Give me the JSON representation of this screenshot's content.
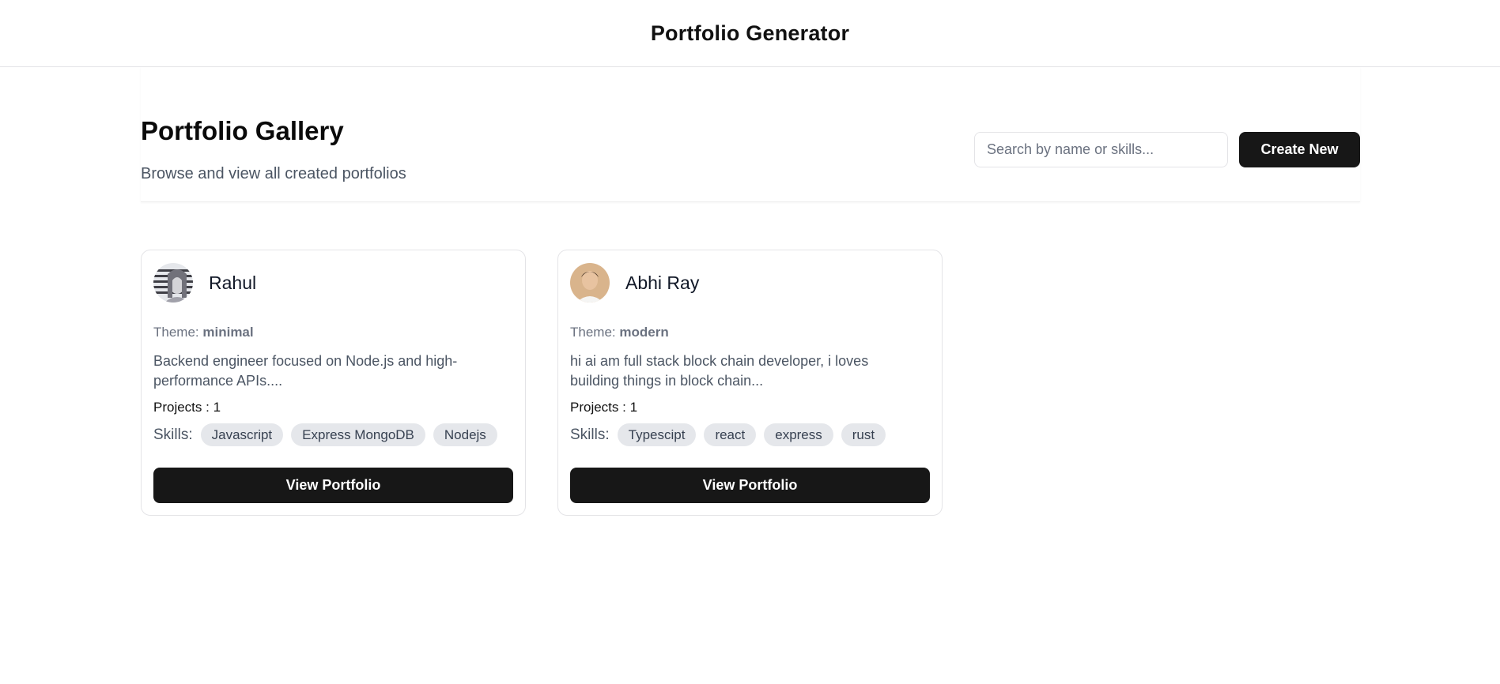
{
  "header": {
    "title": "Portfolio Generator"
  },
  "gallery": {
    "title": "Portfolio Gallery",
    "subtitle": "Browse and view all created portfolios",
    "search_placeholder": "Search by name or skills...",
    "create_label": "Create New"
  },
  "cards": [
    {
      "name": "Rahul",
      "avatar_icon": "avatar-photo-grayscale",
      "theme_label": "Theme:",
      "theme": "minimal",
      "description": "Backend engineer focused on Node.js and high-performance APIs....",
      "projects": "Projects : 1",
      "skills_label": "Skills:",
      "skills": [
        "Javascript",
        "Express MongoDB",
        "Nodejs"
      ],
      "button_label": "View Portfolio"
    },
    {
      "name": "Abhi Ray",
      "avatar_icon": "avatar-photo-color",
      "theme_label": "Theme:",
      "theme": "modern",
      "description": "hi ai am full stack block chain developer, i loves building things in block chain...",
      "projects": "Projects : 1",
      "skills_label": "Skills:",
      "skills": [
        "Typescipt",
        "react",
        "express",
        "rust"
      ],
      "button_label": "View Portfolio"
    }
  ],
  "colors": {
    "primary_button": "#171717",
    "tag_bg": "#e5e7eb",
    "muted_text": "#4b5563",
    "border": "#e4e4e7"
  }
}
